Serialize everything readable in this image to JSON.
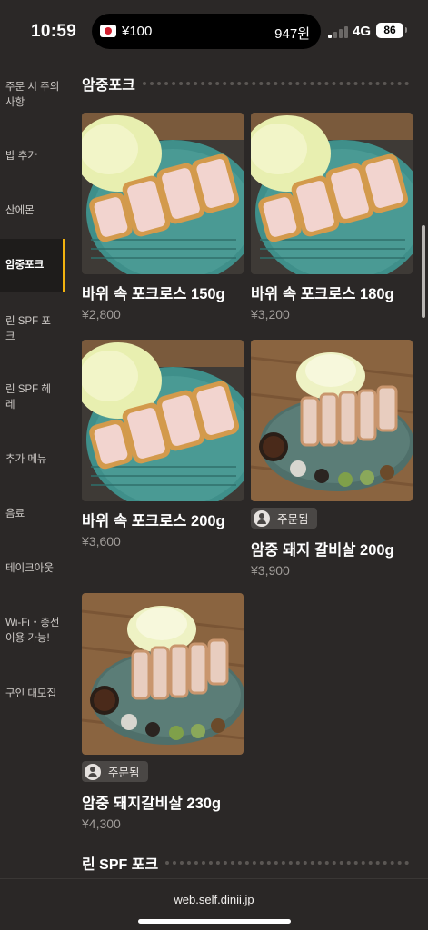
{
  "status_bar": {
    "time": "10:59",
    "island_left": "¥100",
    "island_right": "947원",
    "network": "4G",
    "battery": "86"
  },
  "sidebar": {
    "items": [
      {
        "label": "주문 시 주의 사항",
        "active": false
      },
      {
        "label": "밥 추가",
        "active": false
      },
      {
        "label": "산에몬",
        "active": false
      },
      {
        "label": "암중포크",
        "active": true
      },
      {
        "label": "린 SPF 포크",
        "active": false
      },
      {
        "label": "린 SPF 헤레",
        "active": false
      },
      {
        "label": "추가 메뉴",
        "active": false
      },
      {
        "label": "음료",
        "active": false
      },
      {
        "label": "테이크아웃",
        "active": false
      },
      {
        "label": "Wi-Fi・충전 이용 가능!",
        "active": false
      },
      {
        "label": "구인 대모집",
        "active": false
      }
    ],
    "accent_color": "#f2b20f"
  },
  "sections": [
    {
      "title": "암중포크",
      "items": [
        {
          "name": "바위 속 포크로스 150g",
          "price": "¥2,800",
          "ordered": false,
          "image": "loin-cutlet-photo"
        },
        {
          "name": "바위 속 포크로스 180g",
          "price": "¥3,200",
          "ordered": false,
          "image": "loin-cutlet-photo"
        },
        {
          "name": "바위 속 포크로스 200g",
          "price": "¥3,600",
          "ordered": false,
          "image": "loin-cutlet-photo"
        },
        {
          "name": "암중 돼지 갈비살 200g",
          "price": "¥3,900",
          "ordered": true,
          "image": "rib-cutlet-photo"
        },
        {
          "name": "암중 돼지갈비살 230g",
          "price": "¥4,300",
          "ordered": true,
          "image": "rib-cutlet-photo"
        }
      ]
    },
    {
      "title": "린 SPF 포크",
      "items": []
    }
  ],
  "badge_label": "주문됨",
  "bottom_bar": {
    "url": "web.self.dinii.jp"
  }
}
